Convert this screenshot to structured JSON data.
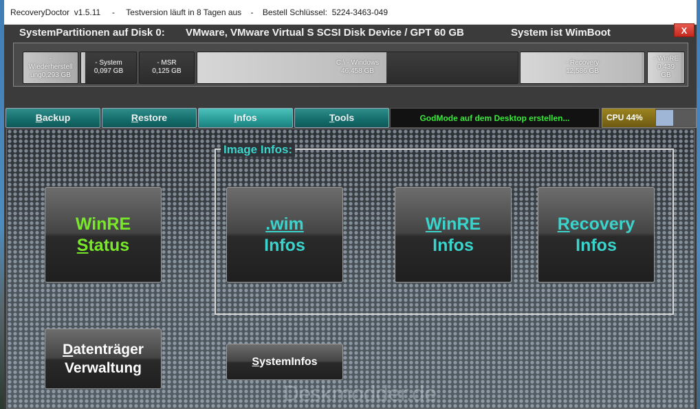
{
  "titlebar": {
    "app_name": "RecoveryDoctor  v1.5.11",
    "trial_text": "Testversion läuft in 8 Tagen aus",
    "key_text": "Bestell Schlüssel:  5224-3463-049",
    "separator": "-",
    "close_label": "X"
  },
  "header": {
    "disk_label": "SystemPartitionen auf Disk 0:",
    "device": "VMware, VMware Virtual S SCSI Disk Device / GPT  60 GB",
    "wimboot": "System ist WimBoot"
  },
  "partitions": [
    {
      "line1": "-",
      "line2": "Wiederherstell",
      "line3": "ung0,293 GB",
      "used": 0.0
    },
    {
      "line1": "- System",
      "line2": "0,097 GB",
      "used": 0.08
    },
    {
      "line1": "- MSR",
      "line2": "0,125 GB",
      "used": 0.0
    },
    {
      "line1": "C:\\ - Windows",
      "line2": "46,458 GB",
      "used": 0.59
    },
    {
      "line1": "- Recovery",
      "line2": "12,586 GB",
      "used": 0.98
    },
    {
      "line1": "- WinRE",
      "line2": "0,439",
      "line3": "GB",
      "used": 0.9
    }
  ],
  "tabs": {
    "backup": {
      "pre": "",
      "accel": "B",
      "post": "ackup"
    },
    "restore": {
      "pre": "",
      "accel": "R",
      "post": "estore"
    },
    "infos": {
      "pre": "",
      "accel": "I",
      "post": "nfos"
    },
    "tools": {
      "pre": "",
      "accel": "T",
      "post": "ools"
    }
  },
  "godmode_text": "GodMode auf dem Desktop erstellen...",
  "cpu": {
    "label": "CPU 44%",
    "level": 0.44
  },
  "image_infos": {
    "group_label": "Image Infos:",
    "wim": {
      "line1": ".wim",
      "line2": "Infos"
    },
    "winre": {
      "accel": "W",
      "line1_rest": "inRE",
      "line2": "Infos"
    },
    "recovery": {
      "accel": "R",
      "line1_rest": "ecovery",
      "line2": "Infos"
    }
  },
  "winre_status": {
    "line1": "WinRE",
    "accel": "S",
    "line2_rest": "tatus"
  },
  "datentraeger": {
    "accel": "D",
    "line1_rest": "atenträger",
    "line2": "Verwaltung"
  },
  "systeminfos": {
    "accel": "S",
    "rest": "ystemInfos"
  },
  "watermark": "Deskmodder.de"
}
